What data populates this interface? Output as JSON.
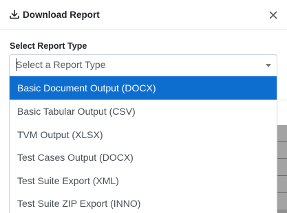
{
  "modal": {
    "title": "Download Report",
    "field_label": "Select Report Type",
    "select_placeholder": "Select a Report Type"
  },
  "dropdown": {
    "options": [
      {
        "label": "Basic Document Output (DOCX)",
        "highlighted": true
      },
      {
        "label": "Basic Tabular Output (CSV)",
        "highlighted": false
      },
      {
        "label": "TVM Output (XLSX)",
        "highlighted": false
      },
      {
        "label": "Test Cases Output (DOCX)",
        "highlighted": false
      },
      {
        "label": "Test Suite Export (XML)",
        "highlighted": false
      },
      {
        "label": "Test Suite ZIP Export (INNO)",
        "highlighted": false
      }
    ]
  },
  "icons": {
    "title_icon": "download-icon",
    "close_icon": "close-icon",
    "select_indicator": "caret-down-icon"
  },
  "colors": {
    "highlight": "#0d6ecf",
    "backdrop": "#8f8f8f",
    "border": "#ced4da"
  }
}
